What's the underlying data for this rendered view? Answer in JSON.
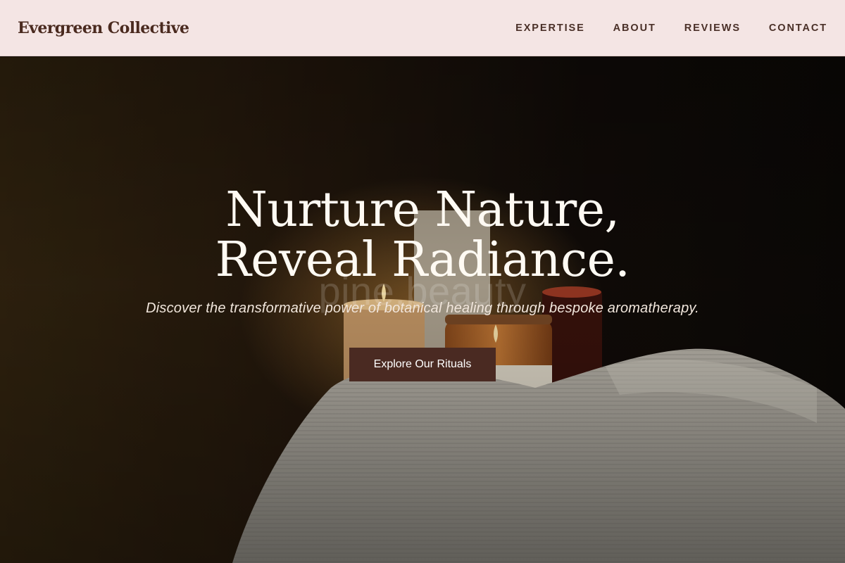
{
  "header": {
    "brand": "Evergreen Collective",
    "nav": [
      "EXPERTISE",
      "ABOUT",
      "REVIEWS",
      "CONTACT"
    ]
  },
  "hero": {
    "headline_line1": "Nurture Nature,",
    "headline_line2": "Reveal Radiance.",
    "watermark": "pine.beauty",
    "subtitle": "Discover the transformative power of botanical healing through bespoke aromatherapy.",
    "cta_label": "Explore Our Rituals"
  },
  "colors": {
    "header_bg": "#f4e5e4",
    "brand_text": "#4a2a1f",
    "cta_bg": "#4a2a22"
  }
}
